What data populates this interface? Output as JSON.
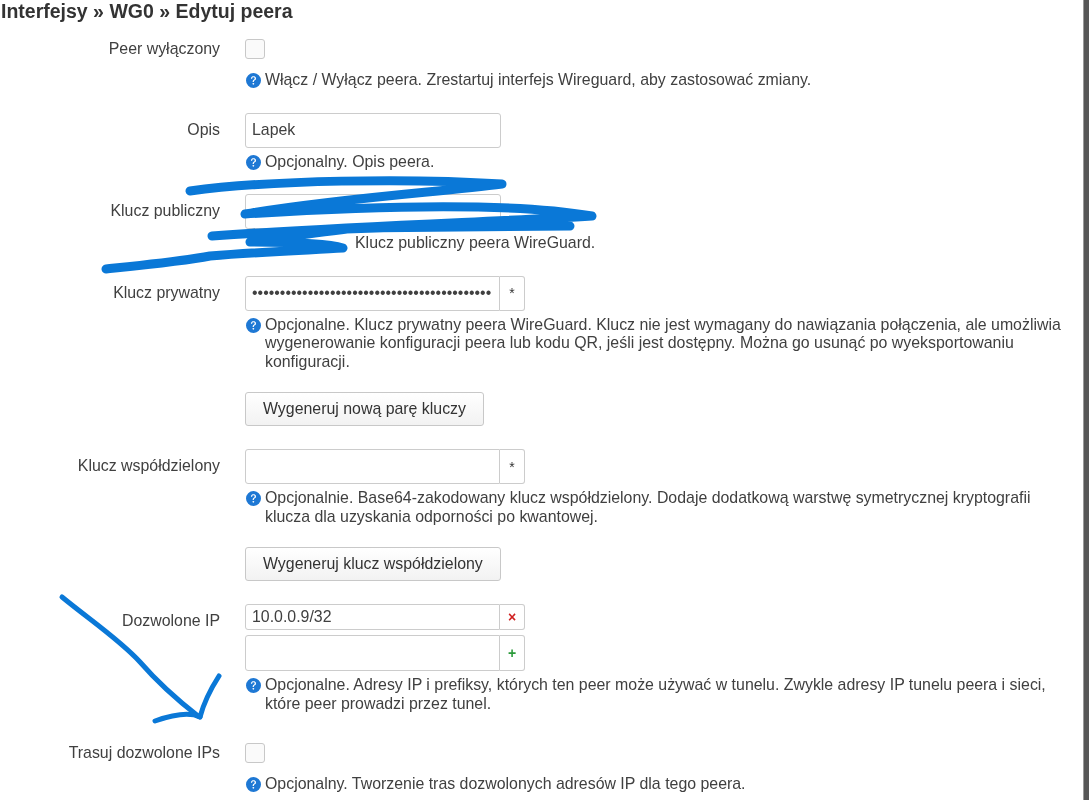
{
  "breadcrumb": {
    "title": "Interfejsy » WG0 » Edytuj peera"
  },
  "fields": [
    {
      "kind": "checkbox",
      "label": "Peer wyłączony",
      "checked": false,
      "hint": "Włącz / Wyłącz peera. Zrestartuj interfejs Wireguard, aby zastosować zmiany."
    },
    {
      "kind": "text",
      "label": "Opis",
      "value": "Lapek",
      "hint": "Opcjonalny. Opis peera."
    },
    {
      "kind": "text",
      "label": "Klucz publiczny",
      "scribbled_over": true,
      "hint": "Klucz publiczny peera WireGuard."
    },
    {
      "kind": "secret",
      "label": "Klucz prywatny",
      "value": "•••••••••••••••••••••••••••••••••••••••••••",
      "button": "*",
      "hint": "Opcjonalne. Klucz prywatny peera WireGuard. Klucz nie jest wymagany do nawiązania połączenia, ale umożliwia wygenerowanie konfiguracji peera lub kodu QR, jeśli jest dostępny. Można go usunąć po wyeksportowaniu konfiguracji.",
      "action": "Wygeneruj nową parę kluczy"
    },
    {
      "kind": "secret",
      "label": "Klucz współdzielony",
      "button": "*",
      "hint": "Opcjonalnie. Base64-zakodowany klucz współdzielony. Dodaje dodatkową warstwę symetrycznej kryptografii klucza dla uzyskania odporności po kwantowej.",
      "action": "Wygeneruj klucz współdzielony"
    },
    {
      "kind": "list",
      "label": "Dozwolone IP",
      "arrow_marked": true,
      "entries": [
        {
          "kind": "remove",
          "value": "10.0.0.9/32",
          "button": "×"
        },
        {
          "kind": "add",
          "button": "+"
        }
      ],
      "hint": "Opcjonalne. Adresy IP i prefiksy, których ten peer może używać w tunelu. Zwykle adresy IP tunelu peera i sieci, które peer prowadzi przez tunel."
    },
    {
      "kind": "checkbox",
      "label": "Trasuj dozwolone IPs",
      "checked": false,
      "hint": "Opcjonalny. Tworzenie tras dozwolonych adresów IP dla tego peera."
    }
  ]
}
